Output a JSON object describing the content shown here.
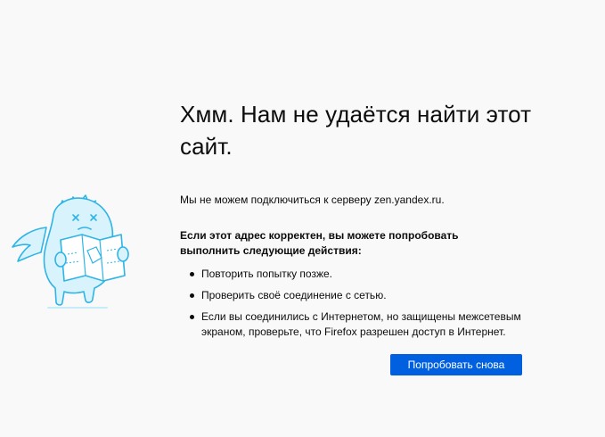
{
  "error_page": {
    "title": "Хмм. Нам не удаётся найти этот сайт.",
    "description": "Мы не можем подключиться к серверу zen.yandex.ru.",
    "advice_title": "Если этот адрес корректен, вы можете попробовать выполнить следующие действия:",
    "steps": [
      {
        "text": "Повторить попытку позже."
      },
      {
        "text": "Проверить своё соединение с сетью."
      },
      {
        "text": "Если вы соединились с Интернетом, но защищены межсетевым экраном, проверьте, что Firefox разрешен доступ в Интернет."
      }
    ],
    "retry_label": "Попробовать снова",
    "illustration": "lost-dinosaur-with-map-icon"
  },
  "colors": {
    "accent": "#0060df",
    "background": "#f9f9fa",
    "illustration_stroke": "#2eb4e6",
    "illustration_fill": "#d9f3fc"
  }
}
